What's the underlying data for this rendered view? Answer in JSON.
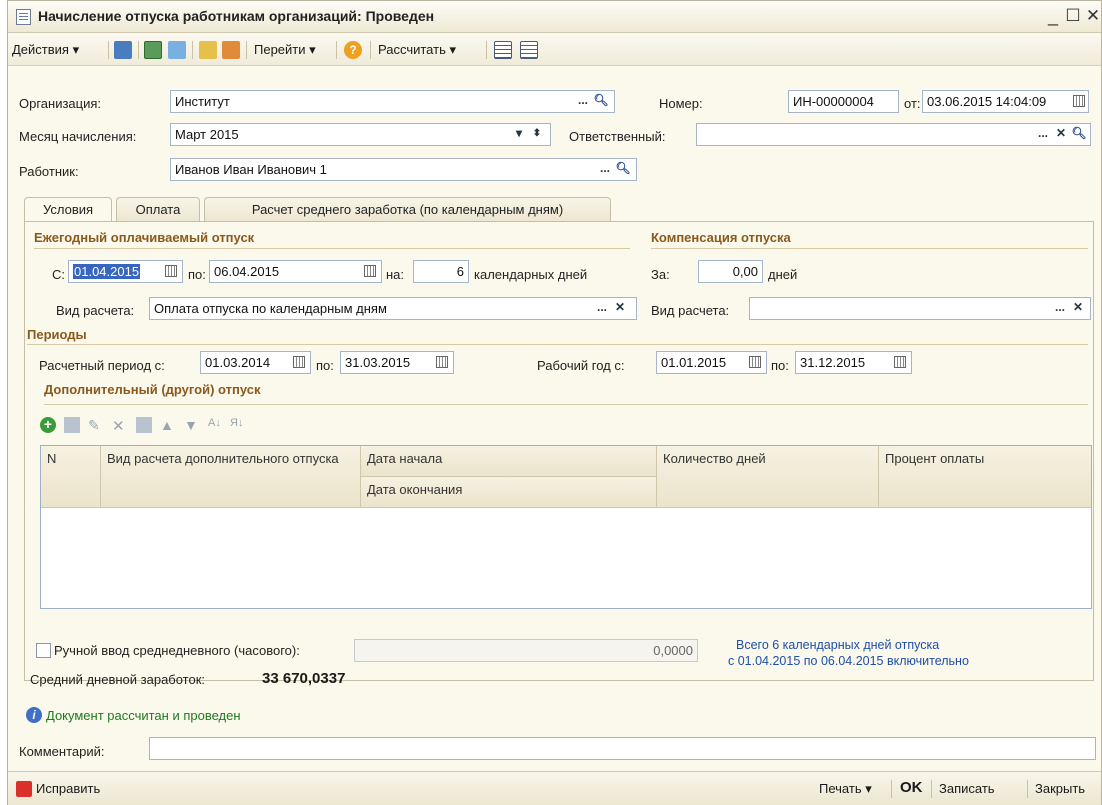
{
  "window": {
    "title": "Начисление отпуска работникам организаций: Проведен"
  },
  "toolbar": {
    "actions": "Действия",
    "goto": "Перейти",
    "calculate": "Рассчитать"
  },
  "header": {
    "org_label": "Организация:",
    "org_value": "Институт",
    "number_label": "Номер:",
    "number_value": "ИН-00000004",
    "date_label": "от:",
    "date_value": "03.06.2015 14:04:09",
    "month_label": "Месяц начисления:",
    "month_value": "Март 2015",
    "responsible_label": "Ответственный:",
    "responsible_value": "",
    "employee_label": "Работник:",
    "employee_value": "Иванов Иван Иванович 1"
  },
  "tabs": [
    "Условия",
    "Оплата",
    "Расчет среднего заработка (по календарным дням)"
  ],
  "annual": {
    "title": "Ежегодный оплачиваемый отпуск",
    "from_label": "С:",
    "from_value": "01.04.2015",
    "to_label": "по:",
    "to_value": "06.04.2015",
    "on_label": "на:",
    "days_value": "6",
    "days_unit": "календарных дней",
    "calc_type_label": "Вид расчета:",
    "calc_type_value": "Оплата отпуска по календарным дням"
  },
  "compensation": {
    "title": "Компенсация отпуска",
    "for_label": "За:",
    "for_value": "0,00",
    "unit": "дней",
    "calc_type_label": "Вид расчета:",
    "calc_type_value": ""
  },
  "periods": {
    "title": "Периоды",
    "calc_label": "Расчетный период с:",
    "calc_from": "01.03.2014",
    "calc_to_label": "по:",
    "calc_to": "31.03.2015",
    "work_label": "Рабочий год с:",
    "work_from": "01.01.2015",
    "work_to_label": "по:",
    "work_to": "31.12.2015"
  },
  "extra": {
    "title": "Дополнительный (другой) отпуск",
    "columns": {
      "n": "N",
      "type": "Вид расчета дополнительного отпуска",
      "start": "Дата начала",
      "end": "Дата окончания",
      "days": "Количество дней",
      "percent": "Процент оплаты"
    }
  },
  "manual": {
    "label": "Ручной ввод среднедневного (часового):",
    "value": "0,0000"
  },
  "summary": {
    "line1": "Всего 6 календарных дней отпуска",
    "line2": "с 01.04.2015 по 06.04.2015 включительно"
  },
  "avg": {
    "label": "Средний дневной заработок:",
    "value": "33 670,0337"
  },
  "info": "Документ рассчитан и проведен",
  "comment": {
    "label": "Комментарий:",
    "value": ""
  },
  "footer": {
    "fix": "Исправить",
    "print": "Печать",
    "ok": "OK",
    "save": "Записать",
    "close": "Закрыть"
  }
}
